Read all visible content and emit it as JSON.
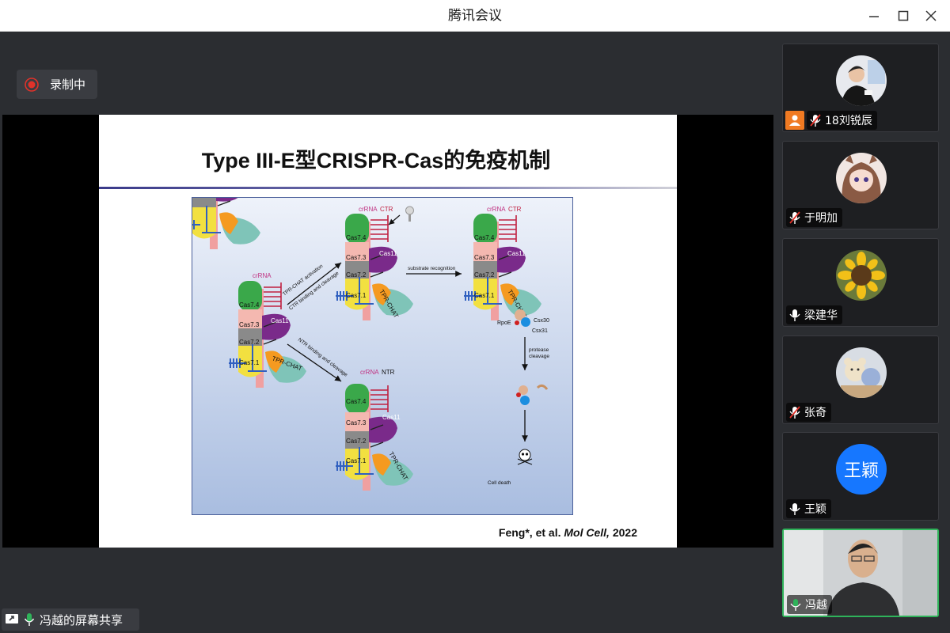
{
  "window": {
    "title": "腾讯会议"
  },
  "recording": {
    "label": "录制中",
    "color": "#e0322a"
  },
  "slide": {
    "title": "Type III-E型CRISPR-Cas的免疫机制",
    "citation_authors": "Feng*, et al. ",
    "citation_journal": "Mol Cell,",
    "citation_year": " 2022",
    "figure": {
      "crRNA": "crRNA",
      "CTR": "CTR",
      "NTR": "NTR",
      "cas74": "Cas7.4",
      "cas73": "Cas7.3",
      "cas72": "Cas7.2",
      "cas71": "Cas7.1",
      "cas11": "Cas11",
      "tpr": "TPR-CHAT",
      "arrow1a": "TPR-CHAT activation",
      "arrow1b": "CTR binding and cleavage",
      "arrow2": "NTR binding and cleavage",
      "arrow3": "substrate recognition",
      "rpoe": "RpoE",
      "csx30": "Csx30",
      "csx31": "Csx31",
      "protease1": "protease",
      "protease2": "cleavage",
      "celldeath": "Cell death"
    }
  },
  "share": {
    "label": "冯越的屏幕共享"
  },
  "participants": [
    {
      "name": "18刘锐辰",
      "mic": "muted",
      "host": true,
      "avatar": "photo-person"
    },
    {
      "name": "于明加",
      "mic": "muted",
      "host": false,
      "avatar": "anime-girl"
    },
    {
      "name": "梁建华",
      "mic": "on",
      "host": false,
      "avatar": "sunflower"
    },
    {
      "name": "张奇",
      "mic": "muted",
      "host": false,
      "avatar": "plush-toys"
    },
    {
      "name": "王颖",
      "mic": "on",
      "host": false,
      "avatar": "initials",
      "initials": "王颖",
      "avatar_color": "#1677ff"
    },
    {
      "name": "冯越",
      "mic": "speaking",
      "host": false,
      "avatar": "video",
      "active": true
    }
  ],
  "colors": {
    "accent_green": "#2fb35a",
    "muted_red": "#e0322a"
  }
}
